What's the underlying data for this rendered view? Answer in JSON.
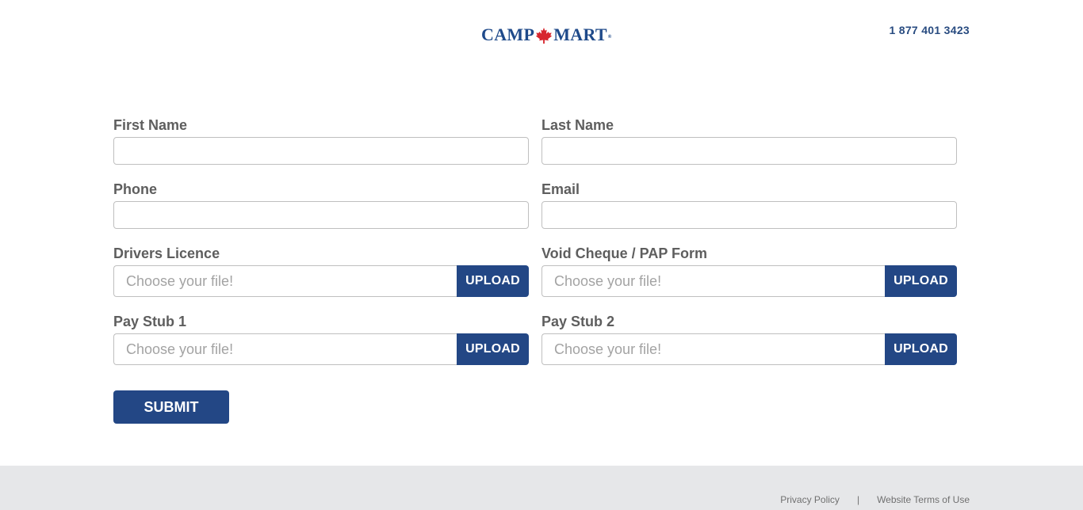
{
  "header": {
    "logo_left": "CAMP",
    "logo_right": "MART",
    "logo_reg": "®",
    "phone": "1 877 401 3423"
  },
  "colors": {
    "brand": "#234785",
    "leaf": "#d7262e",
    "footer_bg": "#e6e7e9"
  },
  "form": {
    "first_name_label": "First Name",
    "last_name_label": "Last Name",
    "phone_label": "Phone",
    "email_label": "Email",
    "drivers_licence_label": "Drivers Licence",
    "void_cheque_label": "Void Cheque / PAP Form",
    "pay_stub_1_label": "Pay Stub 1",
    "pay_stub_2_label": "Pay Stub 2",
    "file_placeholder": "Choose your file!",
    "upload_label": "UPLOAD",
    "submit_label": "SUBMIT"
  },
  "footer": {
    "privacy": "Privacy Policy",
    "separator": "|",
    "terms": "Website Terms of Use"
  }
}
